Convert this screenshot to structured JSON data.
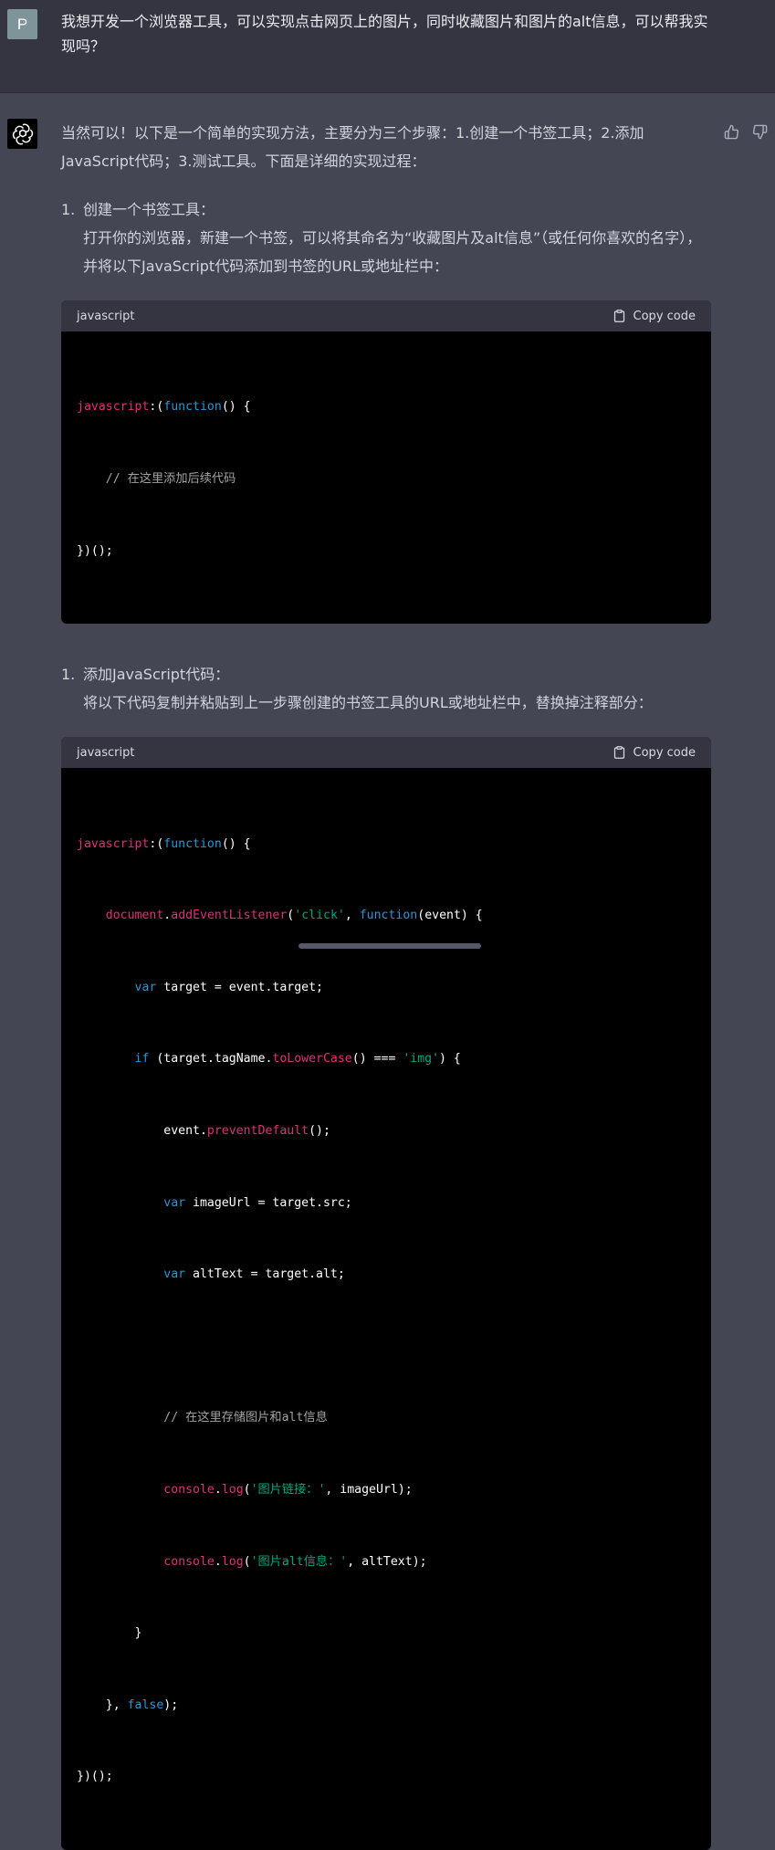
{
  "user": {
    "avatar_letter": "P",
    "message": "我想开发一个浏览器工具，可以实现点击网页上的图片，同时收藏图片和图片的alt信息，可以帮我实现吗？"
  },
  "assistant": {
    "intro": "当然可以！以下是一个简单的实现方法，主要分为三个步骤：1.创建一个书签工具；2.添加JavaScript代码；3.测试工具。下面是详细的实现过程：",
    "steps": [
      {
        "number": "1.",
        "title": "创建一个书签工具：",
        "description": "打开你的浏览器，新建一个书签，可以将其命名为“收藏图片及alt信息”（或任何你喜欢的名字），并将以下JavaScript代码添加到书签的URL或地址栏中：",
        "code": {
          "language": "javascript",
          "copy_label": "Copy code",
          "lines": [
            "javascript:(function() {",
            "    // 在这里添加后续代码",
            "})();"
          ]
        }
      },
      {
        "number": "1.",
        "title": "添加JavaScript代码：",
        "description": "将以下代码复制并粘贴到上一步骤创建的书签工具的URL或地址栏中，替换掉注释部分：",
        "code": {
          "language": "javascript",
          "copy_label": "Copy code",
          "lines": [
            "javascript:(function() {",
            "    document.addEventListener('click', function(event) {",
            "        var target = event.target;",
            "        if (target.tagName.toLowerCase() === 'img') {",
            "            event.preventDefault();",
            "            var imageUrl = target.src;",
            "            var altText = target.alt;",
            "",
            "            // 在这里存储图片和alt信息",
            "            console.log('图片链接：', imageUrl);",
            "            console.log('图片alt信息：', altText);",
            "        }",
            "    }, false);",
            "})();"
          ]
        }
      }
    ]
  },
  "icons": {
    "thumbs_up": "thumbs-up-icon",
    "thumbs_down": "thumbs-down-icon",
    "clipboard": "clipboard-icon",
    "openai_logo": "openai-logo-icon"
  },
  "colors": {
    "user_bg": "#343541",
    "assistant_bg": "#444654",
    "code_bg": "#000000",
    "code_header_bg": "#343541",
    "user_avatar": "#7f9498"
  }
}
